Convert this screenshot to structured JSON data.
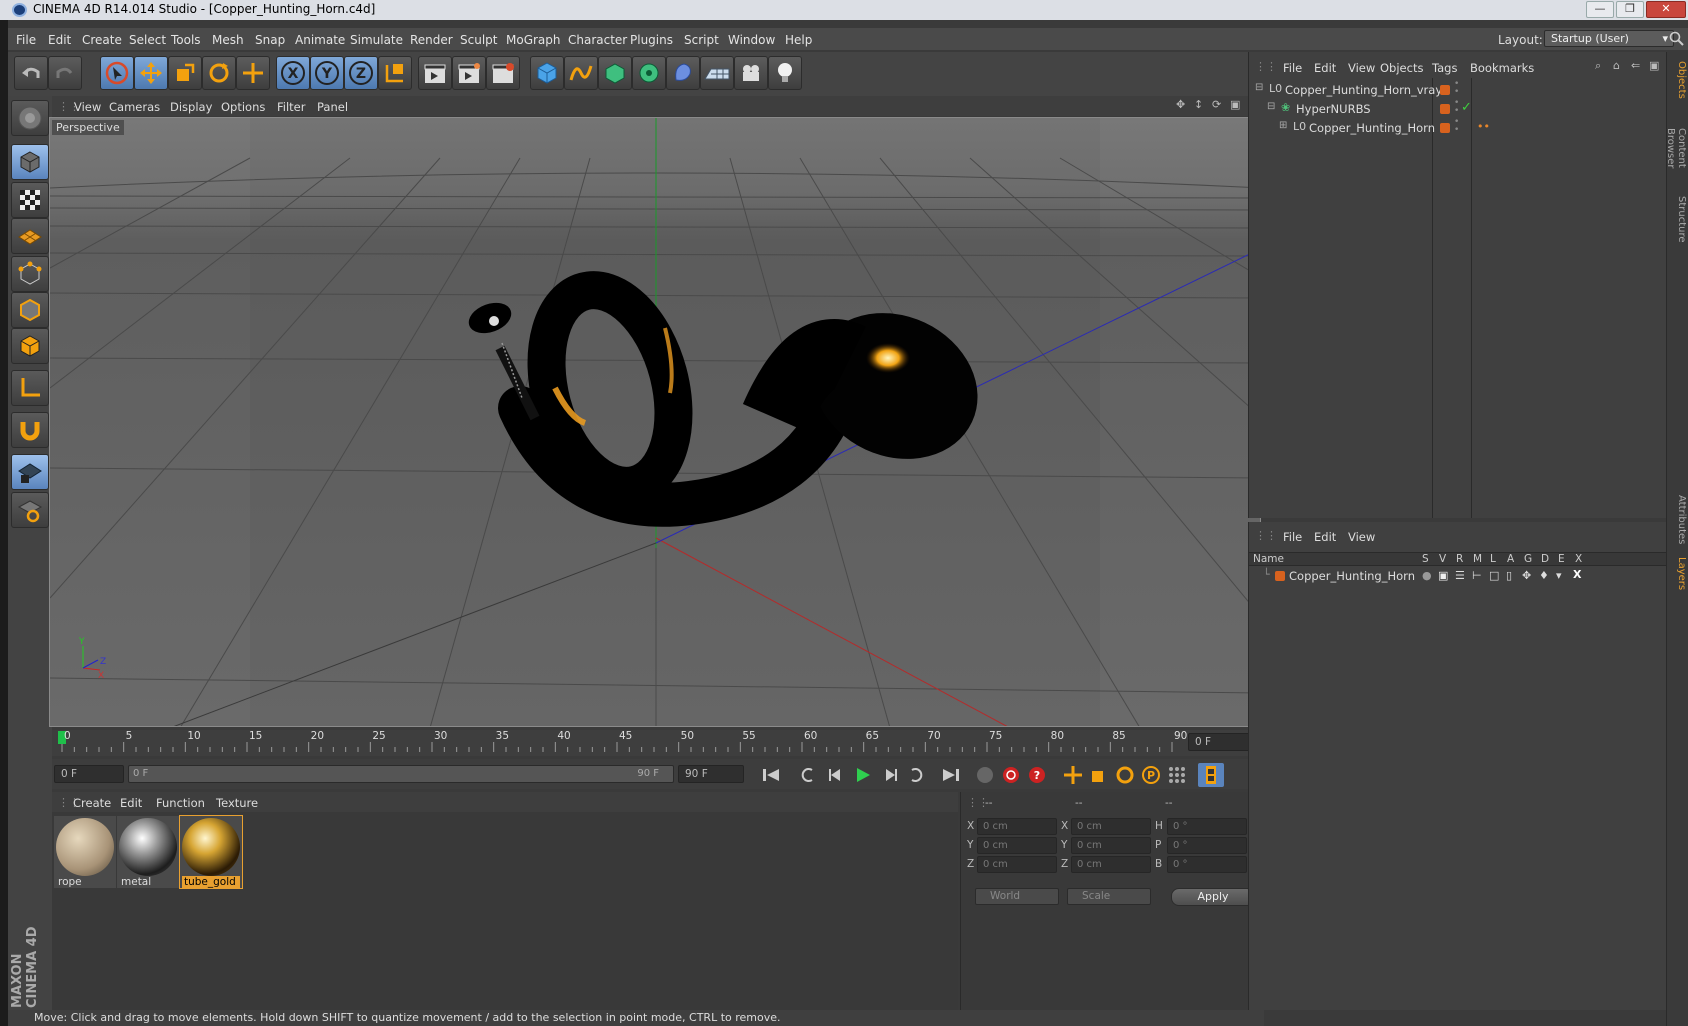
{
  "window": {
    "title": "CINEMA 4D R14.014 Studio - [Copper_Hunting_Horn.c4d]"
  },
  "menu": [
    "File",
    "Edit",
    "Create",
    "Select",
    "Tools",
    "Mesh",
    "Snap",
    "Animate",
    "Simulate",
    "Render",
    "Sculpt",
    "MoGraph",
    "Character",
    "Plugins",
    "Script",
    "Window",
    "Help"
  ],
  "layout": {
    "label": "Layout:",
    "value": "Startup (User)"
  },
  "viewport": {
    "menu": [
      "View",
      "Cameras",
      "Display",
      "Options",
      "Filter",
      "Panel"
    ],
    "label": "Perspective"
  },
  "timeline": {
    "ticks": [
      "0",
      "5",
      "10",
      "15",
      "20",
      "25",
      "30",
      "35",
      "40",
      "45",
      "50",
      "55",
      "60",
      "65",
      "70",
      "75",
      "80",
      "85",
      "90"
    ],
    "current_frame": "0 F",
    "start_field": "0 F",
    "range_start": "0 F",
    "range_end": "90 F",
    "end_field": "90 F"
  },
  "materials": {
    "menu": [
      "Create",
      "Edit",
      "Function",
      "Texture"
    ],
    "items": [
      {
        "name": "rope",
        "color": "#bfae8f"
      },
      {
        "name": "metal",
        "color": "#9a9a9a"
      },
      {
        "name": "tube_gold",
        "color": "#d6a533"
      }
    ]
  },
  "coords": {
    "headers": [
      "--",
      "--",
      "--"
    ],
    "rows": [
      {
        "a_label": "X",
        "a_val": "0 cm",
        "b_label": "X",
        "b_val": "0 cm",
        "c_label": "H",
        "c_val": "0 °"
      },
      {
        "a_label": "Y",
        "a_val": "0 cm",
        "b_label": "Y",
        "b_val": "0 cm",
        "c_label": "P",
        "c_val": "0 °"
      },
      {
        "a_label": "Z",
        "a_val": "0 cm",
        "b_label": "Z",
        "b_val": "0 cm",
        "c_label": "B",
        "c_val": "0 °"
      }
    ],
    "space": "World",
    "mode": "Scale",
    "apply": "Apply"
  },
  "objects": {
    "menu": [
      "File",
      "Edit",
      "View",
      "Objects",
      "Tags",
      "Bookmarks"
    ],
    "items": [
      {
        "name": "Copper_Hunting_Horn_vray"
      },
      {
        "name": "HyperNURBS"
      },
      {
        "name": "Copper_Hunting_Horn"
      }
    ]
  },
  "layers": {
    "menu": [
      "File",
      "Edit",
      "View"
    ],
    "columns": [
      "Name",
      "S",
      "V",
      "R",
      "M",
      "L",
      "A",
      "G",
      "D",
      "E",
      "X"
    ],
    "items": [
      {
        "name": "Copper_Hunting_Horn",
        "color": "#d8621e"
      }
    ]
  },
  "side_tabs": [
    "Objects",
    "Content Browser",
    "Structure",
    "Attributes",
    "Layers"
  ],
  "status": "Move: Click and drag to move elements. Hold down SHIFT to quantize movement / add to the selection in point mode, CTRL to remove.",
  "branding": "MAXON CINEMA 4D",
  "accent": "#e8a030"
}
